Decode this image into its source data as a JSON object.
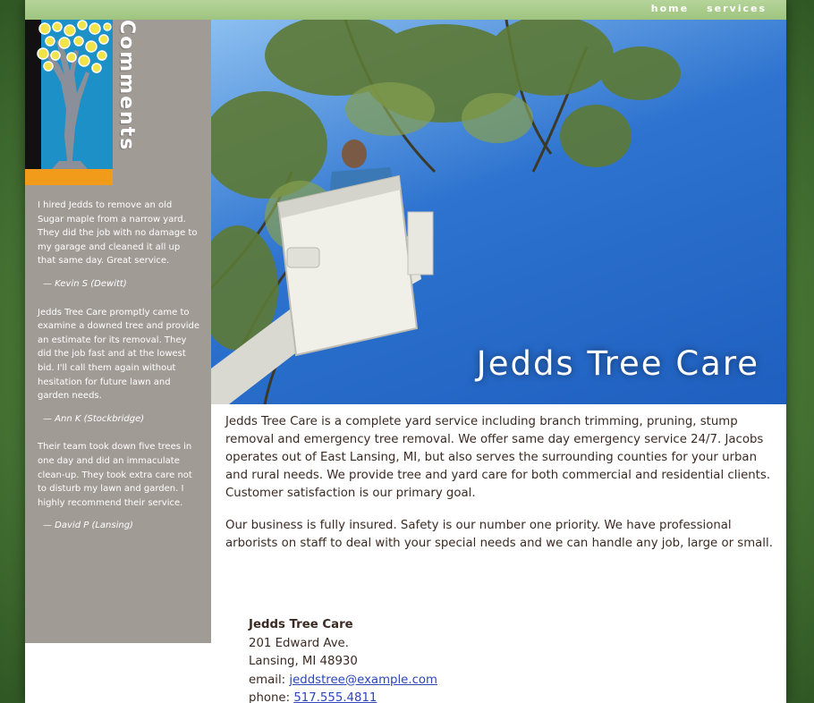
{
  "nav": {
    "items": [
      {
        "label": "home"
      },
      {
        "label": "services"
      }
    ]
  },
  "sidebar": {
    "title": "Comments",
    "testimonials": [
      {
        "quote": "I hired Jedds to remove an old Sugar maple from a narrow yard. They did the job with no damage to my garage and cleaned it all up that same day. Great service.",
        "author": "— Kevin S (Dewitt)"
      },
      {
        "quote": "Jedds Tree Care promptly came to examine a downed tree and provide an estimate for its removal. They did the job fast and at the lowest bid. I'll call them again without hesitation for future lawn and garden needs.",
        "author": "— Ann K (Stockbridge)"
      },
      {
        "quote": "Their team took down five trees in one day and did an immaculate clean-up. They took extra care not to disturb my lawn and garden. I highly recommend their service.",
        "author": "— David P (Lansing)"
      }
    ]
  },
  "hero": {
    "title": "Jedds Tree Care"
  },
  "content": {
    "paragraphs": [
      "Jedds Tree Care is a complete yard service including branch trimming, pruning, stump removal and emergency tree removal. We offer same day emergency service 24/7. Jacobs operates out of East Lansing, MI, but also serves the surrounding counties for your urban and rural needs. We provide tree and yard care for both commercial and residential clients. Customer satisfaction is our primary goal.",
      "Our business is fully insured. Safety is our number one priority. We have professional arborists on staff to deal with your special needs and we can handle any job, large or small."
    ]
  },
  "address": {
    "name": "Jedds Tree Care",
    "street": "201 Edward Ave.",
    "city": "Lansing, MI 48930",
    "email_label": "email: ",
    "email": "jeddstree@example.com",
    "phone_label": "phone: ",
    "phone": "517.555.4811"
  },
  "colors": {
    "frame": "#3d6b2f",
    "sidebar": "#a19b96",
    "topbar": "#a7cc88",
    "logo_sky": "#1e90c8",
    "logo_ground": "#f29b1b",
    "link": "#2d46b8",
    "text": "#3b2a22"
  }
}
